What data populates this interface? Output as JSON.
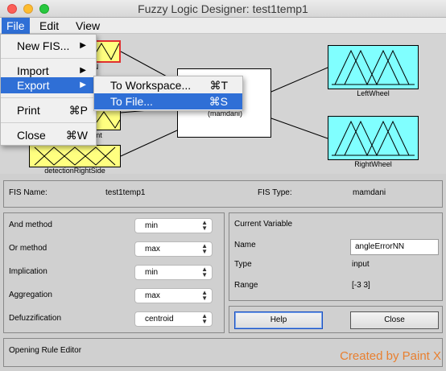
{
  "window": {
    "title": "Fuzzy Logic Designer: test1temp1"
  },
  "menubar": {
    "file": "File",
    "edit": "Edit",
    "view": "View"
  },
  "file_menu": {
    "new_fis": "New FIS...",
    "import": "Import",
    "export": "Export",
    "print": "Print",
    "print_shortcut": "⌘P",
    "close": "Close",
    "close_shortcut": "⌘W"
  },
  "export_menu": {
    "to_workspace": "To Workspace...",
    "to_workspace_shortcut": "⌘T",
    "to_file": "To File...",
    "to_file_shortcut": "⌘S"
  },
  "diagram": {
    "inputs": [
      "detectionRightSide"
    ],
    "partial_labels": [
      "N",
      "nt"
    ],
    "fis_type": "(mamdani)",
    "outputs": [
      "LeftWheel",
      "RightWheel"
    ]
  },
  "fis_info": {
    "name_label": "FIS Name:",
    "name_value": "test1temp1",
    "type_label": "FIS Type:",
    "type_value": "mamdani"
  },
  "methods": [
    {
      "label": "And method",
      "value": "min"
    },
    {
      "label": "Or method",
      "value": "max"
    },
    {
      "label": "Implication",
      "value": "min"
    },
    {
      "label": "Aggregation",
      "value": "max"
    },
    {
      "label": "Defuzzification",
      "value": "centroid"
    }
  ],
  "current_variable": {
    "title": "Current Variable",
    "name_label": "Name",
    "name_value": "angleErrorNN",
    "type_label": "Type",
    "type_value": "input",
    "range_label": "Range",
    "range_value": "[-3 3]"
  },
  "buttons": {
    "help": "Help",
    "close": "Close"
  },
  "status": {
    "text": "Opening Rule Editor"
  },
  "watermark": "Created by Paint X"
}
